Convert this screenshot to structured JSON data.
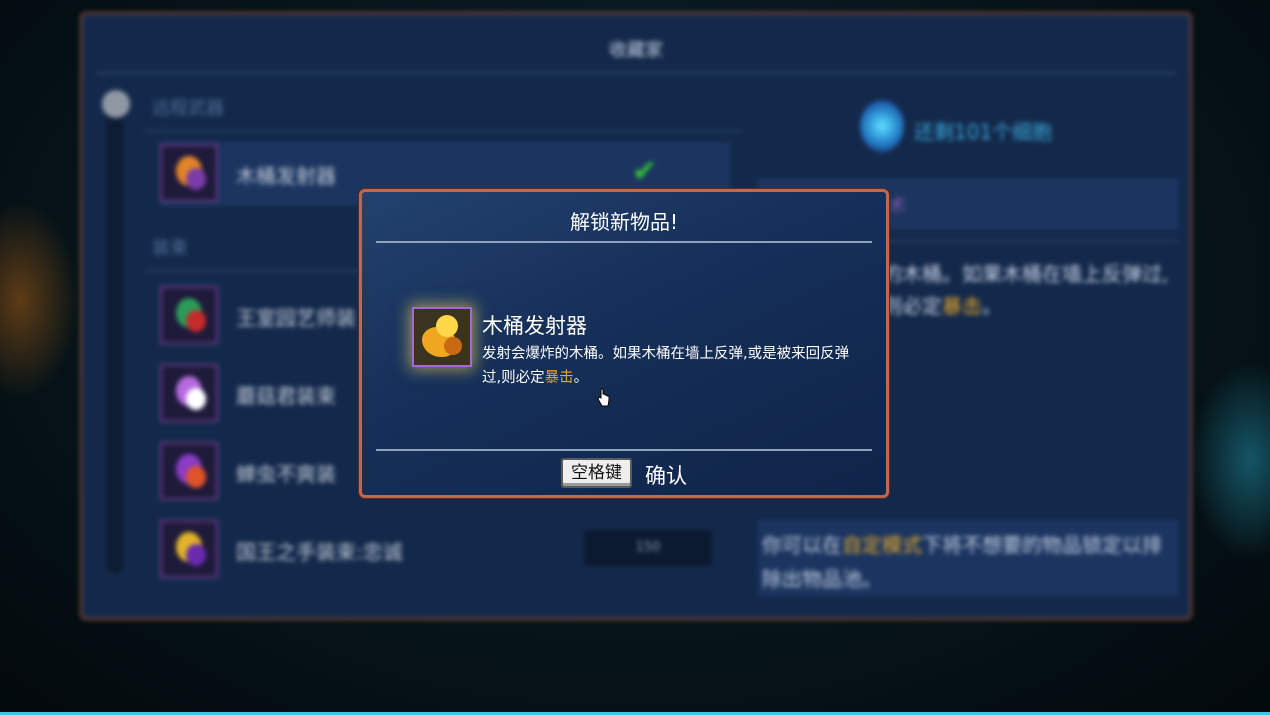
{
  "collector": {
    "title": "收藏家",
    "sections": [
      {
        "label": "远程武器"
      },
      {
        "label": "装束"
      }
    ],
    "items": [
      {
        "name": "木桶发射器",
        "status": "unlocked",
        "colors": [
          "#e2842a",
          "#7a3ca8"
        ]
      },
      {
        "name": "王室园艺师装",
        "colors": [
          "#2a9d5a",
          "#c62a2a"
        ]
      },
      {
        "name": "蘑菇君装束",
        "colors": [
          "#b76ae0",
          "#ffffff"
        ]
      },
      {
        "name": "蝉虫不爽装",
        "colors": [
          "#8a3cc6",
          "#e0542a"
        ]
      },
      {
        "name": "国王之手装束:忠诚",
        "cost": "150",
        "colors": [
          "#e2b32a",
          "#6a2ab0"
        ]
      }
    ],
    "cells_remaining": "还剩101个细胞",
    "detail_fragment": "术",
    "detail_desc_prefix": "的木桶。如果木桶在墙上反弹过,则必定",
    "detail_desc_link": "暴击",
    "detail_desc_suffix": "。",
    "tip_prefix": "你可以在",
    "tip_link": "自定模式",
    "tip_suffix": "下将不想要的物品锁定以排除出物品池。"
  },
  "dialog": {
    "title": "解锁新物品!",
    "item_name": "木桶发射器",
    "desc_prefix": "发射会爆炸的木桶。如果木桶在墙上反弹,或是被来回反弹过,则必定",
    "desc_link": "暴击",
    "desc_suffix": "。",
    "key_hint": "空格键",
    "confirm_label": "确认"
  },
  "colors": {
    "panel_bg": "#13294b",
    "panel_border": "#8a4a36",
    "dialog_border": "#c1674c",
    "highlight_gold": "#e8a92b",
    "check_green": "#33c43a",
    "cell_blue": "#3aa6d6"
  }
}
